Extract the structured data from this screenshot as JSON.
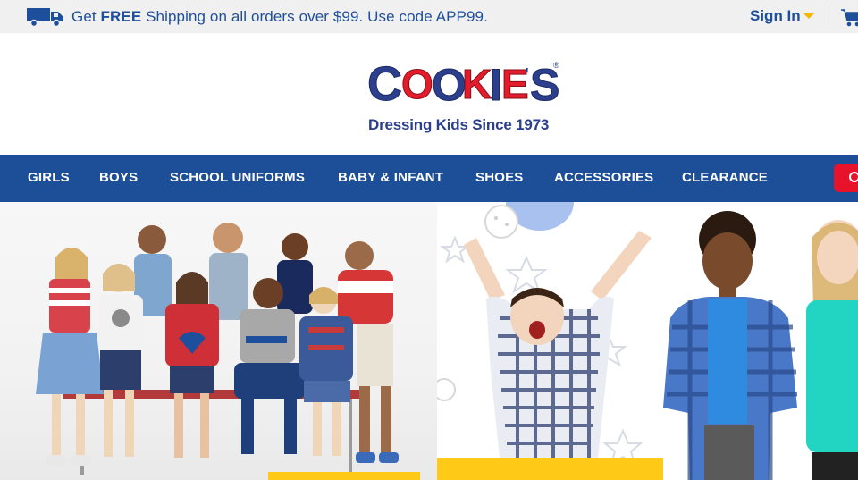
{
  "promo": {
    "prefix": "Get ",
    "highlight": "FREE",
    "suffix": " Shipping on all orders over $99. Use code APP99.",
    "icon": "truck-icon"
  },
  "account": {
    "signin_label": "Sign In",
    "caret_color": "#f5b800",
    "cart_icon": "cart-icon"
  },
  "brand": {
    "logo_text": "COOKIE'S",
    "registered": "®",
    "tagline": "Dressing Kids Since 1973",
    "blue": "#2c3f8c",
    "red": "#e31c2b"
  },
  "nav": {
    "items": [
      {
        "label": "GIRLS"
      },
      {
        "label": "BOYS"
      },
      {
        "label": "SCHOOL UNIFORMS"
      },
      {
        "label": "BABY & INFANT"
      },
      {
        "label": "SHOES"
      },
      {
        "label": "ACCESSORIES"
      },
      {
        "label": "CLEARANCE"
      }
    ],
    "background": "#1d4f98",
    "search_color": "#e8132b"
  },
  "hero": {
    "panels": [
      {
        "name": "group-of-kids-photo"
      },
      {
        "name": "toddler-celebrating-photo"
      },
      {
        "name": "kids-in-shirts-photo"
      }
    ],
    "accent_yellow": "#ffc917"
  }
}
